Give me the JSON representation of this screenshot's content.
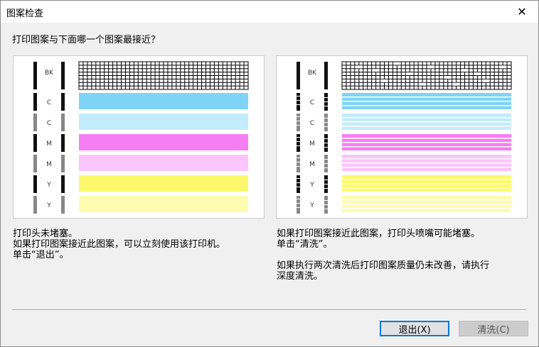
{
  "window": {
    "title": "图案检查",
    "close_glyph": "✕"
  },
  "question": "打印图案与下面哪一个图案最接近？",
  "left": {
    "lines": [
      "打印头未堵塞。",
      "如果打印图案接近此图案，可以立刻使用该打印机。",
      "单击“退出”。"
    ]
  },
  "right": {
    "lines": [
      "如果打印图案接近此图案，打印头喷嘴可能堵塞。",
      "单击“清洗”。"
    ],
    "note": [
      "如果执行两次清洗后打印图案质量仍未改善，请执行",
      "深度清洗。"
    ]
  },
  "pattern_labels": [
    "BK",
    "C",
    "C",
    "M",
    "M",
    "Y",
    "Y"
  ],
  "colors": {
    "cyan": "#7fd3f7",
    "light_cyan": "#c4ebfb",
    "magenta": "#f57ef5",
    "light_magenta": "#fbc4fb",
    "yellow": "#fbf96b",
    "light_yellow": "#fdfbb0"
  },
  "buttons": {
    "exit": "退出(X)",
    "clean": "清洗(C)"
  }
}
